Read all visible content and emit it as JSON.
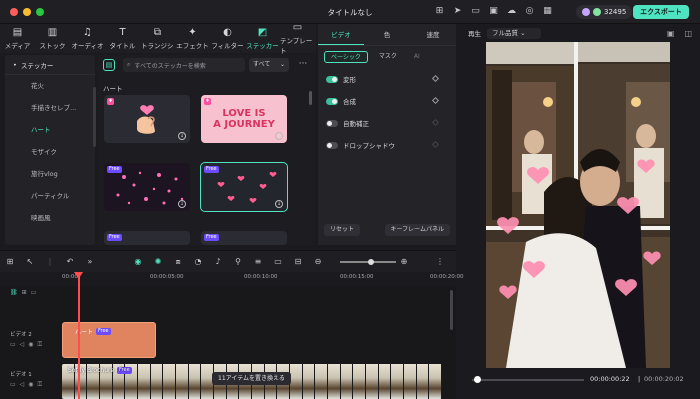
{
  "window": {
    "title": "タイトルなし"
  },
  "account": {
    "credits": "32495",
    "export_label": "エクスポート"
  },
  "toolbar": {
    "tabs": [
      {
        "label": "メディア",
        "icon": "media-icon"
      },
      {
        "label": "ストック",
        "icon": "stock-icon"
      },
      {
        "label": "オーディオ",
        "icon": "audio-icon"
      },
      {
        "label": "タイトル",
        "icon": "title-icon"
      },
      {
        "label": "トランジション",
        "icon": "transition-icon"
      },
      {
        "label": "エフェクト",
        "icon": "effect-icon"
      },
      {
        "label": "フィルター",
        "icon": "filter-icon"
      },
      {
        "label": "ステッカー",
        "icon": "sticker-icon",
        "active": true
      },
      {
        "label": "テンプレート",
        "icon": "template-icon"
      }
    ]
  },
  "sidebar": {
    "header": "ステッカー",
    "items": [
      {
        "label": "花火"
      },
      {
        "label": "手描きセレブ..."
      },
      {
        "label": "ハート",
        "active": true
      },
      {
        "label": "モザイク"
      },
      {
        "label": "旅行vlog"
      },
      {
        "label": "パーティクル"
      },
      {
        "label": "映画風"
      }
    ]
  },
  "stickers": {
    "search_placeholder": "すべてのステッカーを検索",
    "filter_value": "すべて",
    "section_title": "ハート",
    "thumb2_text_line1": "LOVE IS",
    "thumb2_text_line2": "A JOURNEY",
    "free_badge": "Free"
  },
  "properties": {
    "tabs": [
      {
        "label": "ビデオ",
        "active": true
      },
      {
        "label": "色"
      },
      {
        "label": "速度"
      }
    ],
    "subtabs": [
      {
        "label": "ベーシック",
        "active": true
      },
      {
        "label": "マスク"
      },
      {
        "label": "AI"
      }
    ],
    "rows": [
      {
        "label": "変形",
        "on": true
      },
      {
        "label": "合成",
        "on": true
      },
      {
        "label": "自動補正",
        "on": false
      },
      {
        "label": "ドロップシャドウ",
        "on": false
      }
    ],
    "reset_label": "リセット",
    "keyframe_label": "キーフレームパネル"
  },
  "preview": {
    "play_label": "再生",
    "quality": "フル品質",
    "current_time": "00:00:00:22",
    "total_time": "00:00:20:02"
  },
  "timeline": {
    "ruler": [
      "00:00",
      "00:00:05:00",
      "00:00:10:00",
      "00:00:15:00",
      "00:00:20:00"
    ],
    "tracks": [
      {
        "label": "ビデオ 2"
      },
      {
        "label": "ビデオ 1"
      }
    ],
    "sticker_clip": "ハート",
    "video_clip": "Softly Brochure",
    "replace_tooltip": "11アイテムを置き換える"
  },
  "colors": {
    "accent": "#4fe3c1",
    "playhead": "#ff4d4d",
    "sticker_clip": "#e0845f"
  }
}
